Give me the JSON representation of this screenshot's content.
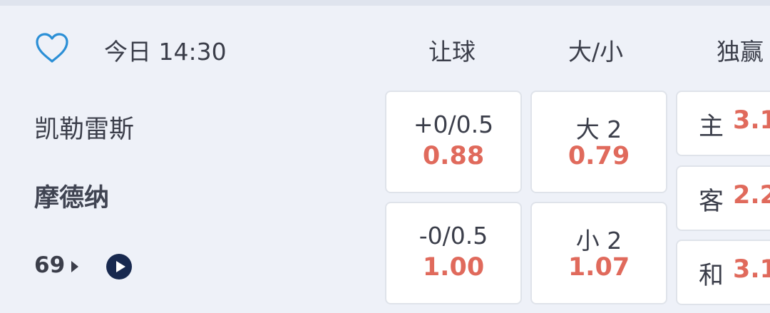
{
  "match": {
    "time": "今日 14:30",
    "home_team": "凯勒雷斯",
    "away_team": "摩德纳",
    "minute": "69"
  },
  "columns": {
    "handicap": "让球",
    "over_under": "大/小",
    "moneyline": "独赢"
  },
  "handicap": [
    {
      "line": "+0/0.5",
      "odds": "0.88"
    },
    {
      "line": "-0/0.5",
      "odds": "1.00"
    }
  ],
  "over_under": [
    {
      "line": "大 2",
      "odds": "0.79"
    },
    {
      "line": "小 2",
      "odds": "1.07"
    }
  ],
  "moneyline": [
    {
      "label": "主",
      "odds": "3.1"
    },
    {
      "label": "客",
      "odds": "2.2"
    },
    {
      "label": "和",
      "odds": "3.1"
    }
  ],
  "colors": {
    "background": "#eef1f8",
    "odds": "#e06a5c",
    "accent_blue": "#2b8fd6",
    "play_button": "#18294f"
  },
  "icons": [
    "heart-icon",
    "chevron-right-icon",
    "play-icon"
  ]
}
